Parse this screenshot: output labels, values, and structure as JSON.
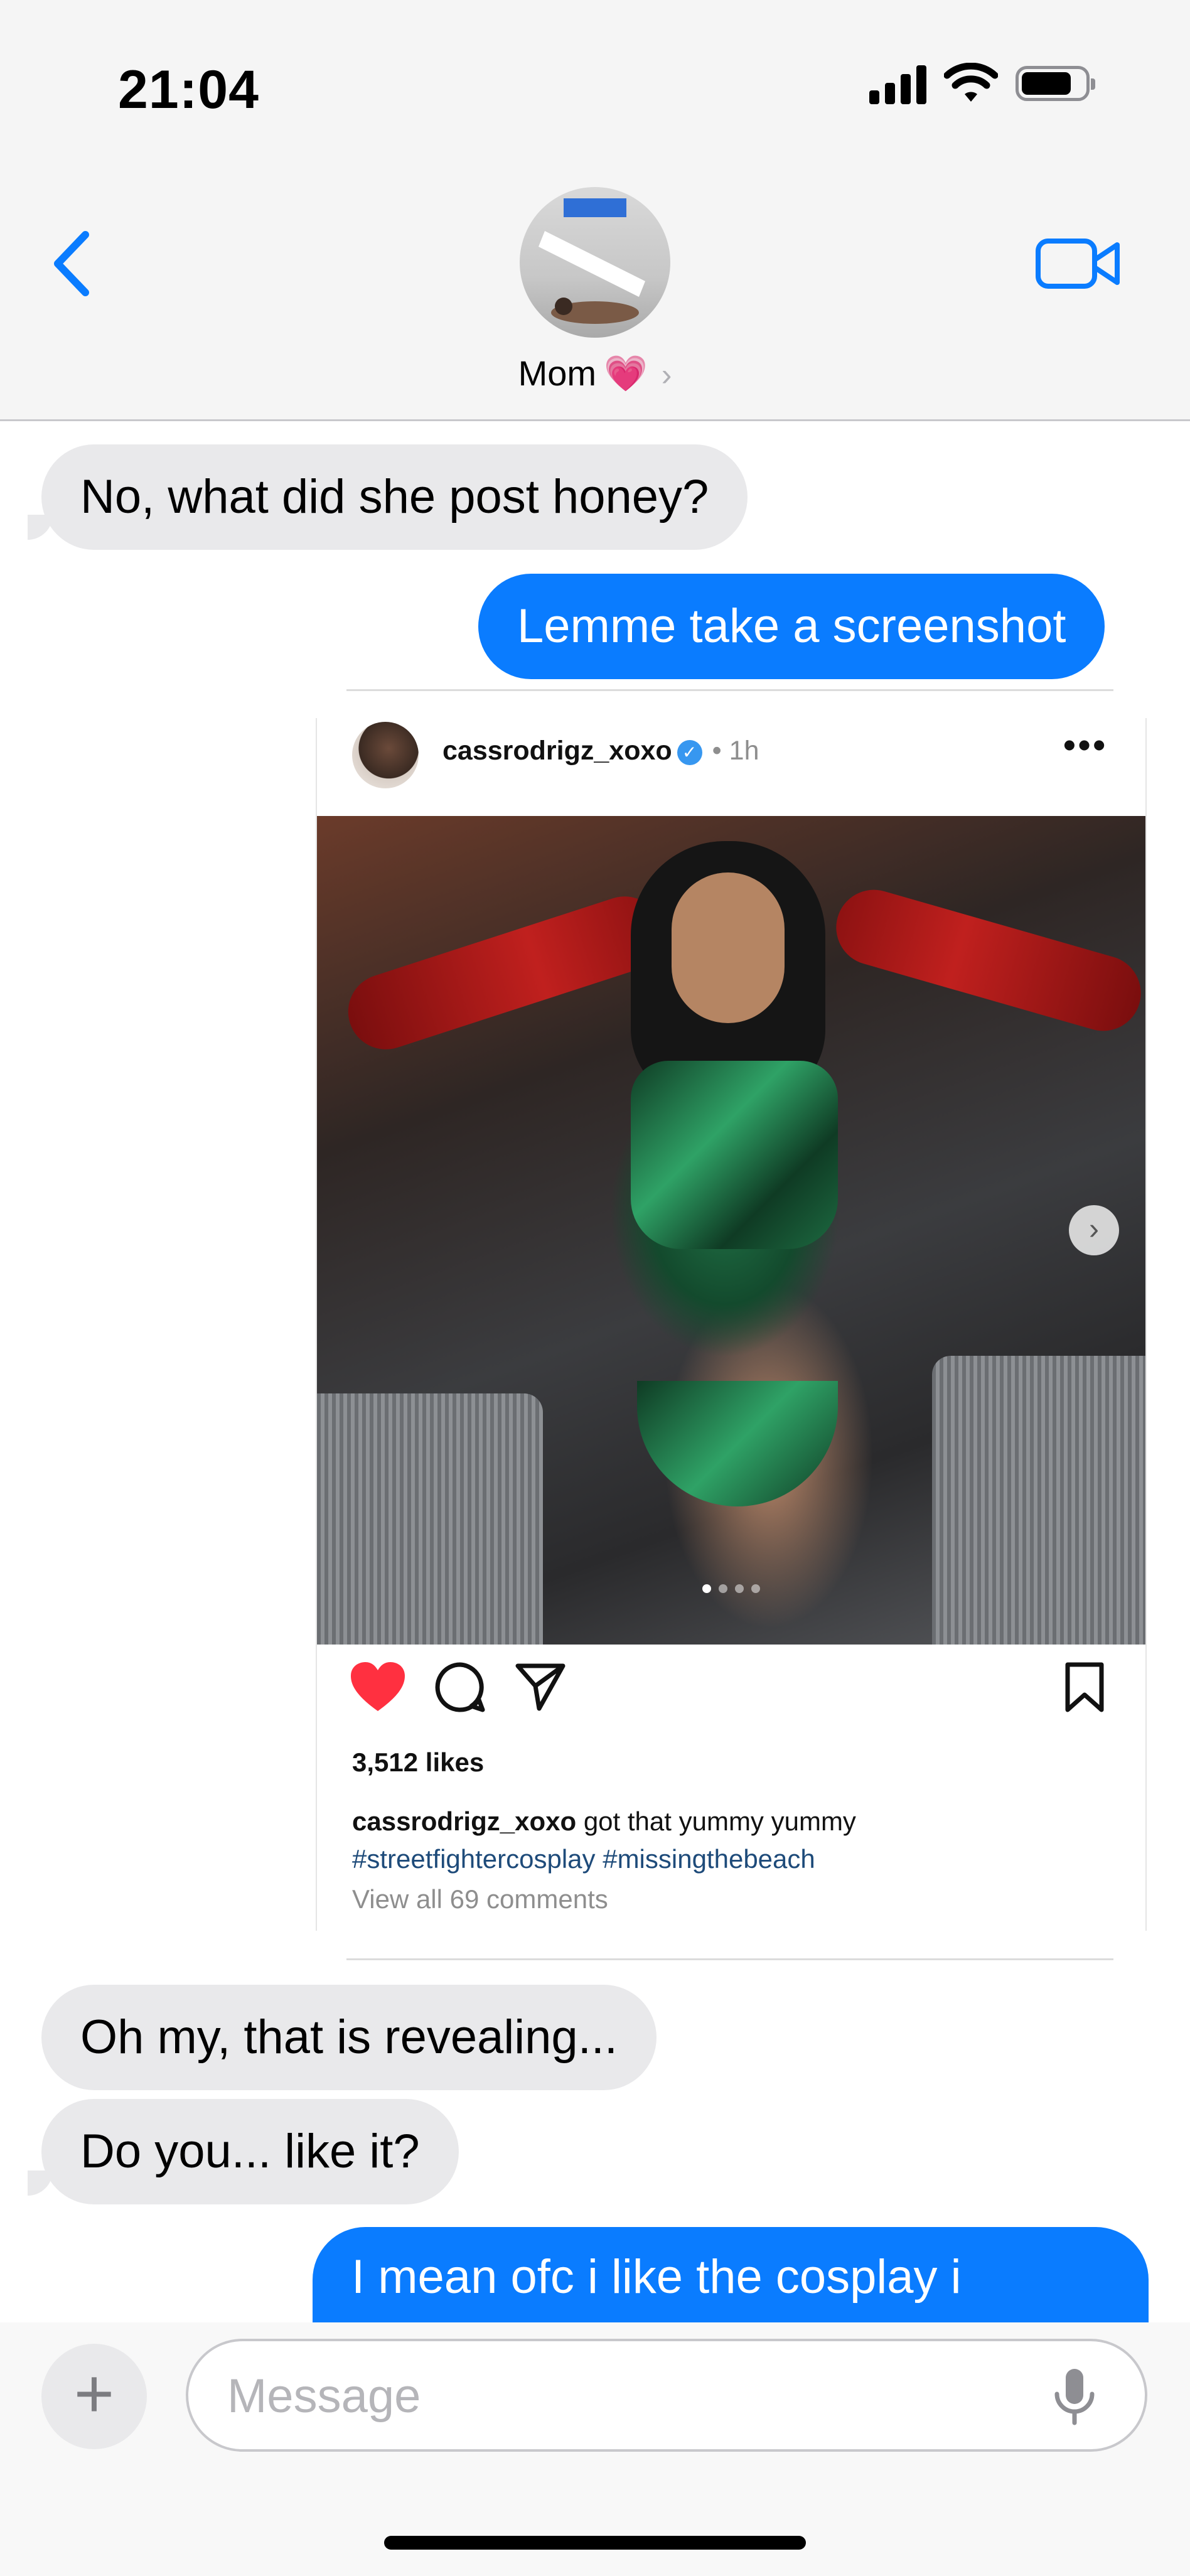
{
  "status_bar": {
    "time": "21:04"
  },
  "header": {
    "contact_name": "Mom",
    "contact_emoji": "💗",
    "chevron": "›"
  },
  "messages": [
    {
      "direction": "received",
      "text": "No, what did she post honey?"
    },
    {
      "direction": "sent",
      "text": "Lemme take a screenshot"
    },
    {
      "direction": "received",
      "text": "Oh my, that is revealing..."
    },
    {
      "direction": "received",
      "text": "Do you... like it?"
    },
    {
      "direction": "sent",
      "text": "I mean ofc i like the cosplay i"
    }
  ],
  "instagram_post": {
    "username": "cassrodrigz_xoxo",
    "verified_mark": "✓",
    "time": "• 1h",
    "more": "•••",
    "next": "›",
    "likes": "3,512 likes",
    "caption_user": "cassrodrigz_xoxo",
    "caption_text": " got that yummy yummy",
    "hashtags": "#streetfightercosplay #missingthebeach",
    "view_comments": "View all 69 comments",
    "liked": true,
    "carousel_index": 1,
    "carousel_count": 4
  },
  "composer": {
    "plus": "+",
    "placeholder": "Message"
  },
  "colors": {
    "accent": "#0a7cff",
    "received_bubble": "#e9e9eb",
    "like_red": "#ff3040"
  },
  "icons": [
    "back-chevron-icon",
    "video-camera-icon",
    "heart-icon",
    "comment-icon",
    "share-icon",
    "bookmark-icon",
    "microphone-icon",
    "plus-icon"
  ]
}
